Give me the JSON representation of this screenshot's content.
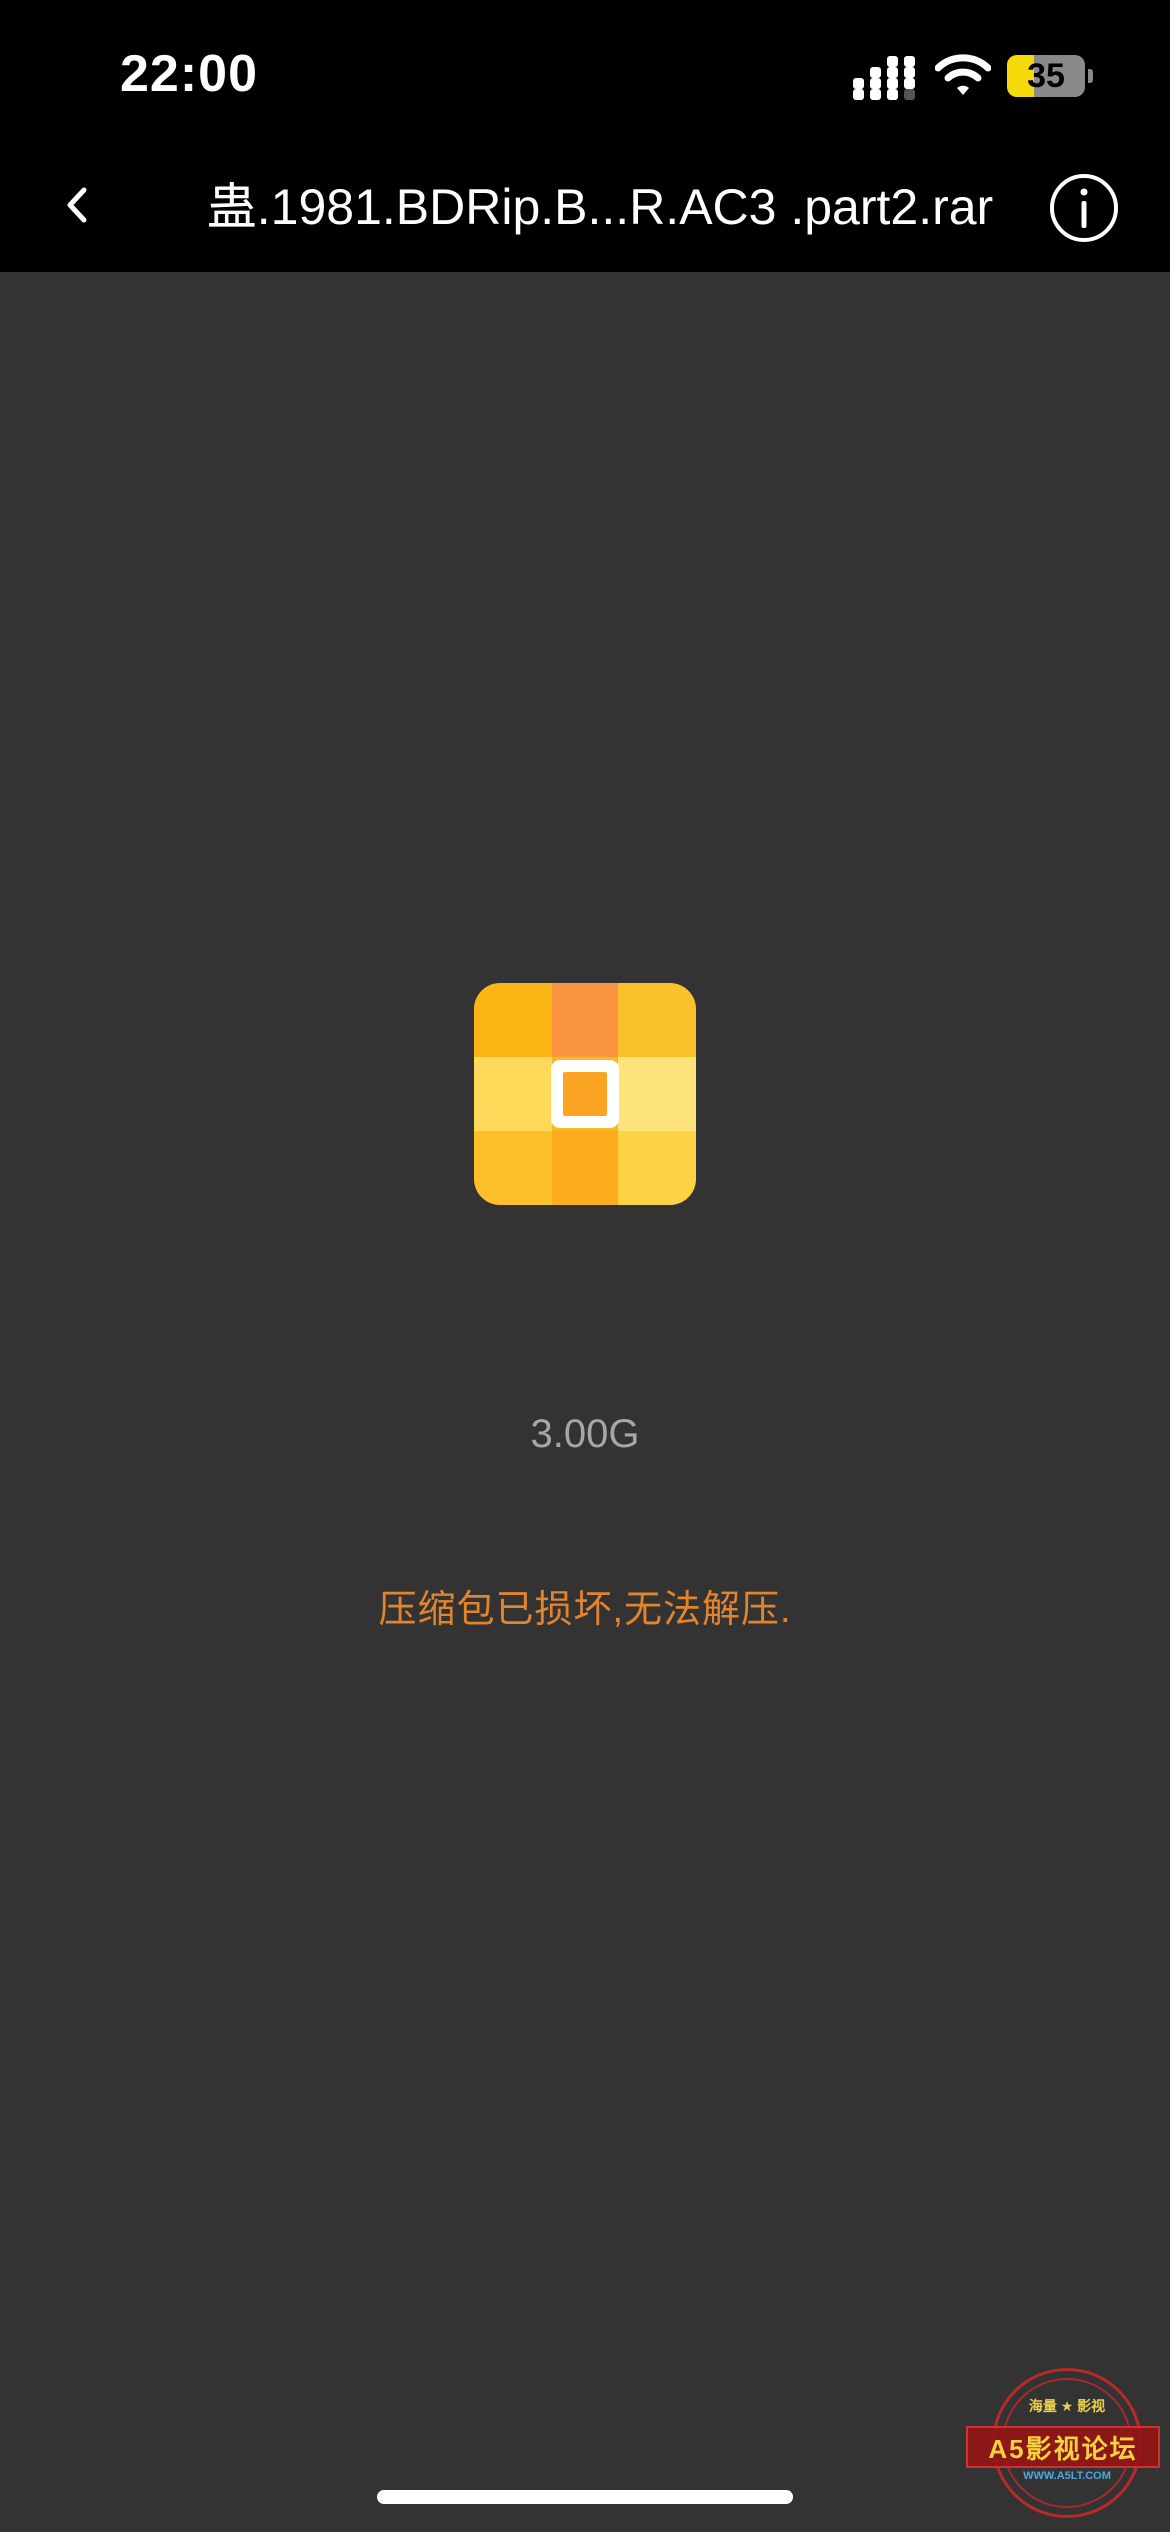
{
  "status_bar": {
    "time": "22:00",
    "battery_percent": "35",
    "battery_level": 0.35,
    "cellular_bars_filled": 3,
    "icons": [
      "cellular-signal-icon",
      "wifi-icon",
      "battery-charging-icon"
    ]
  },
  "nav": {
    "back_icon": "chevron-left-icon",
    "title": "蛊.1981.BDRip.B...R.AC3 .part2.rar",
    "info_icon": "info-circle-icon"
  },
  "file": {
    "icon": "archive-file-icon",
    "size": "3.00G",
    "error_message": "压缩包已损坏,无法解压."
  },
  "watermark": {
    "top_text": "海量 ★ 影视",
    "banner_text": "A5影视论坛",
    "url": "WWW.A5LT.COM"
  },
  "colors": {
    "background": "#333333",
    "bar_background": "#000000",
    "error_text": "#e2832e",
    "size_text": "#a6a6a6",
    "icon_yellow": "#fbbd1f",
    "icon_orange": "#fb9440"
  }
}
